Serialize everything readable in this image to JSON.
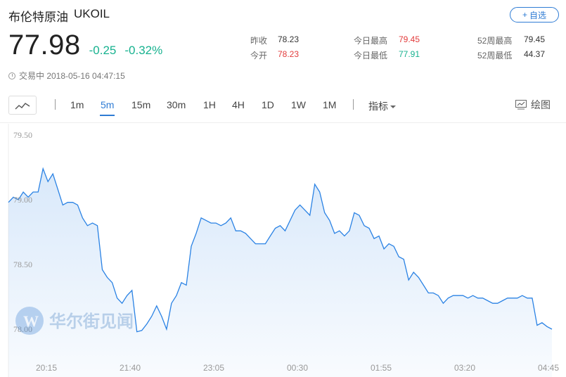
{
  "header": {
    "name": "布伦特原油",
    "code": "UKOIL",
    "price": "77.98",
    "change": "-0.25",
    "change_pct": "-0.32%",
    "status": "交易中 2018-05-16 04:47:15",
    "follow_label": "自选"
  },
  "stats": {
    "prev_close_label": "昨收",
    "prev_close": "78.23",
    "open_label": "今开",
    "open": "78.23",
    "high_label": "今日最高",
    "high": "79.45",
    "low_label": "今日最低",
    "low": "77.91",
    "w52_high_label": "52周最高",
    "w52_high": "79.45",
    "w52_low_label": "52周最低",
    "w52_low": "44.37"
  },
  "toolbar": {
    "periods": [
      "1m",
      "5m",
      "15m",
      "30m",
      "1H",
      "4H",
      "1D",
      "1W",
      "1M"
    ],
    "active_period": "5m",
    "indicator_label": "指标",
    "draw_label": "绘图"
  },
  "watermark": "华尔街见闻",
  "colors": {
    "accent": "#2f7cd4",
    "down": "#17b28f",
    "up": "#e23b3b",
    "line": "#2a82e4"
  },
  "chart_data": {
    "type": "area",
    "x_ticks": [
      "20:15",
      "21:40",
      "23:05",
      "00:30",
      "01:55",
      "03:20",
      "04:45"
    ],
    "y_ticks": [
      "79.50",
      "79.00",
      "78.50",
      "78.00"
    ],
    "ylim": [
      78.0,
      79.5
    ],
    "x_range_minutes": [
      0,
      510
    ],
    "points": [
      [
        0,
        78.98
      ],
      [
        5,
        79.02
      ],
      [
        10,
        79.0
      ],
      [
        15,
        79.06
      ],
      [
        20,
        79.02
      ],
      [
        25,
        79.06
      ],
      [
        30,
        79.06
      ],
      [
        35,
        79.24
      ],
      [
        40,
        79.14
      ],
      [
        45,
        79.2
      ],
      [
        50,
        79.08
      ],
      [
        55,
        78.96
      ],
      [
        60,
        78.98
      ],
      [
        65,
        78.98
      ],
      [
        70,
        78.96
      ],
      [
        75,
        78.86
      ],
      [
        80,
        78.8
      ],
      [
        85,
        78.82
      ],
      [
        90,
        78.8
      ],
      [
        95,
        78.46
      ],
      [
        100,
        78.4
      ],
      [
        105,
        78.36
      ],
      [
        110,
        78.24
      ],
      [
        115,
        78.2
      ],
      [
        120,
        78.26
      ],
      [
        125,
        78.3
      ],
      [
        130,
        77.98
      ],
      [
        135,
        77.99
      ],
      [
        140,
        78.04
      ],
      [
        145,
        78.1
      ],
      [
        150,
        78.18
      ],
      [
        155,
        78.1
      ],
      [
        160,
        78.0
      ],
      [
        165,
        78.2
      ],
      [
        170,
        78.26
      ],
      [
        175,
        78.36
      ],
      [
        180,
        78.34
      ],
      [
        185,
        78.64
      ],
      [
        190,
        78.74
      ],
      [
        195,
        78.86
      ],
      [
        200,
        78.84
      ],
      [
        205,
        78.82
      ],
      [
        210,
        78.82
      ],
      [
        215,
        78.8
      ],
      [
        220,
        78.82
      ],
      [
        225,
        78.86
      ],
      [
        230,
        78.76
      ],
      [
        235,
        78.76
      ],
      [
        240,
        78.74
      ],
      [
        245,
        78.7
      ],
      [
        250,
        78.66
      ],
      [
        255,
        78.66
      ],
      [
        260,
        78.66
      ],
      [
        265,
        78.72
      ],
      [
        270,
        78.78
      ],
      [
        275,
        78.8
      ],
      [
        280,
        78.76
      ],
      [
        285,
        78.84
      ],
      [
        290,
        78.92
      ],
      [
        295,
        78.96
      ],
      [
        300,
        78.92
      ],
      [
        305,
        78.88
      ],
      [
        310,
        79.12
      ],
      [
        315,
        79.06
      ],
      [
        320,
        78.9
      ],
      [
        325,
        78.84
      ],
      [
        330,
        78.74
      ],
      [
        335,
        78.76
      ],
      [
        340,
        78.72
      ],
      [
        345,
        78.76
      ],
      [
        350,
        78.9
      ],
      [
        355,
        78.88
      ],
      [
        360,
        78.8
      ],
      [
        365,
        78.78
      ],
      [
        370,
        78.7
      ],
      [
        375,
        78.72
      ],
      [
        380,
        78.62
      ],
      [
        385,
        78.66
      ],
      [
        390,
        78.64
      ],
      [
        395,
        78.56
      ],
      [
        400,
        78.54
      ],
      [
        405,
        78.38
      ],
      [
        410,
        78.44
      ],
      [
        415,
        78.4
      ],
      [
        420,
        78.34
      ],
      [
        425,
        78.28
      ],
      [
        430,
        78.28
      ],
      [
        435,
        78.26
      ],
      [
        440,
        78.2
      ],
      [
        445,
        78.24
      ],
      [
        450,
        78.26
      ],
      [
        455,
        78.26
      ],
      [
        460,
        78.26
      ],
      [
        465,
        78.24
      ],
      [
        470,
        78.26
      ],
      [
        475,
        78.24
      ],
      [
        480,
        78.24
      ],
      [
        485,
        78.22
      ],
      [
        490,
        78.2
      ],
      [
        495,
        78.2
      ],
      [
        500,
        78.22
      ],
      [
        505,
        78.24
      ],
      [
        510,
        78.24
      ],
      [
        515,
        78.24
      ],
      [
        520,
        78.26
      ],
      [
        525,
        78.24
      ],
      [
        530,
        78.24
      ],
      [
        535,
        78.03
      ],
      [
        540,
        78.05
      ],
      [
        545,
        78.02
      ],
      [
        550,
        78.0
      ]
    ]
  }
}
